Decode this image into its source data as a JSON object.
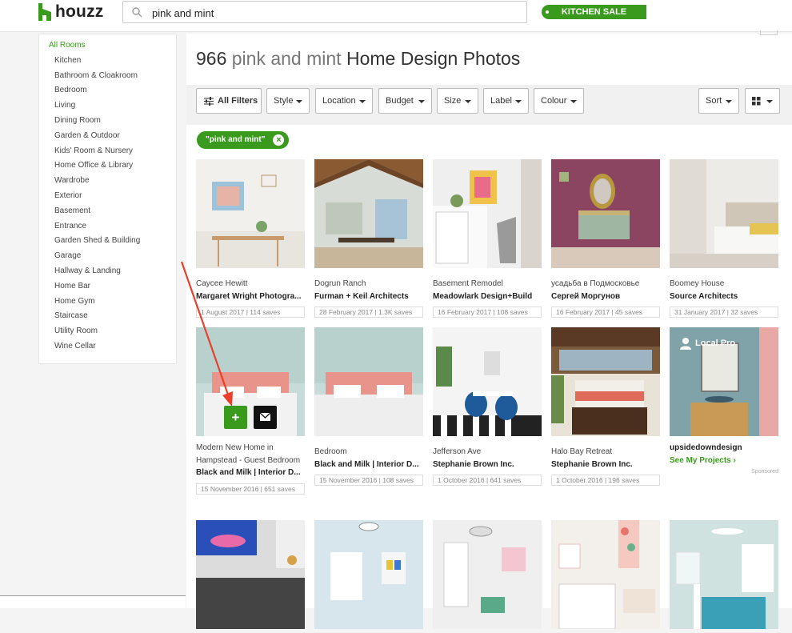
{
  "app": {
    "logo_text": "houzz",
    "search_value": "pink and mint",
    "sale_label": "KITCHEN SALE"
  },
  "sidebar": {
    "items": [
      "All Rooms",
      "Kitchen",
      "Bathroom & Cloakroom",
      "Bedroom",
      "Living",
      "Dining Room",
      "Garden & Outdoor",
      "Kids' Room & Nursery",
      "Home Office & Library",
      "Wardrobe",
      "Exterior",
      "Basement",
      "Entrance",
      "Garden Shed & Building",
      "Garage",
      "Hallway & Landing",
      "Home Bar",
      "Home Gym",
      "Staircase",
      "Utility Room",
      "Wine Cellar"
    ],
    "active": 0
  },
  "heading": {
    "count": "966",
    "query": "pink and mint",
    "suffix": "Home Design Photos"
  },
  "filters": {
    "all_filters": "All Filters",
    "style": "Style",
    "location": "Location",
    "budget": "Budget",
    "size": "Size",
    "label": "Label",
    "colour": "Colour",
    "sort": "Sort"
  },
  "chip": {
    "label": "\"pink and mint\"",
    "close": "×"
  },
  "row1": [
    {
      "title": "Caycee Hewitt",
      "by": "Margaret Wright Photogra...",
      "meta": "1 August 2017 | 114 saves"
    },
    {
      "title": "Dogrun Ranch",
      "by": "Furman + Keil Architects",
      "meta": "28 February 2017 | 1.3K saves"
    },
    {
      "title": "Basement Remodel",
      "by": "Meadowlark Design+Build",
      "meta": "16 February 2017 | 108 saves"
    },
    {
      "title": "усадьба в Подмосковье",
      "by": "Сергей Моргунов",
      "meta": "16 February 2017 | 45 saves"
    },
    {
      "title": "Boomey House",
      "by": "Source Architects",
      "meta": "31 January 2017 | 32 saves"
    }
  ],
  "row2": [
    {
      "title": "Modern New Home in Hampstead - Guest Bedroom",
      "by": "Black and Milk | Interior D...",
      "meta": "15 November 2016 | 651 saves"
    },
    {
      "title": "Bedroom",
      "by": "Black and Milk | Interior D...",
      "meta": "15 November 2016 | 108 saves"
    },
    {
      "title": "Jefferson Ave",
      "by": "Stephanie Brown Inc.",
      "meta": "1 October 2016 | 641 saves"
    },
    {
      "title": "Halo Bay Retreat",
      "by": "Stephanie Brown Inc.",
      "meta": "1 October 2016 | 196 saves"
    }
  ],
  "sponsored_card": {
    "badge": "Local Pro",
    "name": "upsidedowndesign",
    "link": "See My Projects",
    "link_arrow": "›",
    "sponsored": "Sponsored"
  },
  "overlay": {
    "add": "+"
  },
  "colors": {
    "brand": "#3a9a1d",
    "annotation_arrow": "#e8402a"
  }
}
